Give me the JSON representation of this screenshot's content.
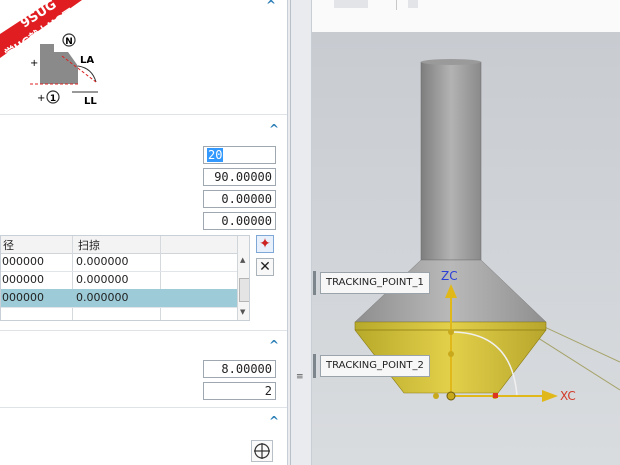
{
  "watermark": {
    "line1": "9SUG",
    "line2": "学UG就上UG网"
  },
  "diagram": {
    "label_n": "N",
    "label_la": "LA",
    "label_ll": "LL",
    "label_1": "1"
  },
  "parameters": {
    "field1": "20",
    "field2": "90.00000",
    "field3": "0.00000",
    "field4": "0.00000"
  },
  "table": {
    "headers": [
      "径",
      "扫掠"
    ],
    "rows": [
      [
        "000000",
        "0.000000"
      ],
      [
        "000000",
        "0.000000"
      ],
      [
        "000000",
        "0.000000"
      ]
    ],
    "selected_row": 2
  },
  "section3": {
    "field1": "8.00000",
    "field2": "2"
  },
  "viewport": {
    "tracking_point_1": "TRACKING_POINT_1",
    "tracking_point_2": "TRACKING_POINT_2",
    "axis_zc": "ZC",
    "axis_xc": "XC",
    "colors": {
      "zc": "#2b3fd6",
      "xc": "#d23c2a",
      "tool_body": "#9a9a9a",
      "tool_tip": "#d9c43a"
    }
  }
}
